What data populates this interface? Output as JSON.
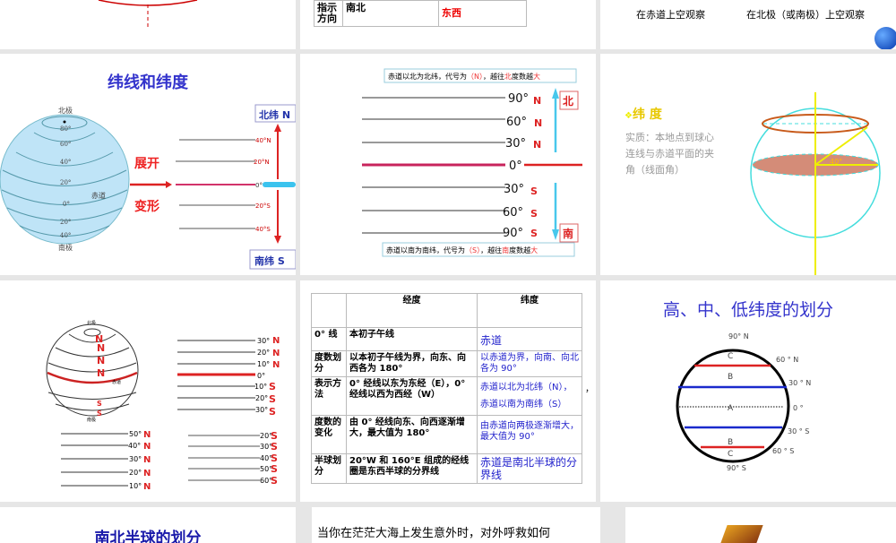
{
  "slides": {
    "s2": {
      "row_label": "指示方向",
      "lon": "南北",
      "lat": "东西"
    },
    "s3": {
      "caption_equator": "在赤道上空观察",
      "caption_pole": "在北极（或南极）上空观察"
    },
    "s4": {
      "title": "纬线和纬度",
      "north_pole": "北极",
      "south_pole": "南极",
      "equator": "赤道",
      "globe_labels": [
        "80°",
        "60°",
        "40°",
        "20°",
        "0°",
        "20°",
        "40°"
      ],
      "expand": "展开",
      "deform": "变形",
      "north_lat": "北纬 N",
      "south_lat": "南纬 S",
      "line_labels": [
        "40°N",
        "20°N",
        "0°",
        "20°S",
        "40°S"
      ]
    },
    "s5": {
      "north_note_pre": "赤道以北为北纬，代号为",
      "north_code": "（N）",
      "north_note_mid": "，越往",
      "north_word": "北",
      "note_deg": "度数越",
      "big": "大",
      "south_note_pre": "赤道以南为南纬，代号为",
      "south_code": "（S）",
      "south_note_mid": "，越往",
      "south_word": "南",
      "degrees": [
        "90°",
        "60°",
        "30°",
        "0°",
        "30°",
        "60°",
        "90°"
      ],
      "letters": [
        "N",
        "N",
        "N",
        "",
        "S",
        "S",
        "S"
      ],
      "north_tag": "北",
      "south_tag": "南"
    },
    "s6": {
      "heading": "纬 度",
      "text": "实质：本地点到球心连线与赤道平面的夹角（线面角）",
      "angle": "40°"
    },
    "s7": {
      "north_pole": "北极",
      "south_pole": "南极",
      "equator": "赤道",
      "globe_letters": [
        "N",
        "N",
        "N",
        "N",
        "S",
        "S"
      ],
      "right_degs": [
        "30°",
        "20°",
        "10°",
        "0°",
        "10°",
        "20°",
        "30°"
      ],
      "right_letters": [
        "N",
        "N",
        "N",
        "",
        "S",
        "S",
        "S"
      ],
      "left_bottom_degs": [
        "50°",
        "40°",
        "30°",
        "20°",
        "10°"
      ],
      "left_bottom_letters": [
        "N",
        "N",
        "N",
        "N",
        "N"
      ],
      "right_bottom_degs": [
        "20°",
        "30°",
        "40°",
        "50°",
        "60°"
      ],
      "right_bottom_letters": [
        "S",
        "S",
        "S",
        "S",
        "S"
      ]
    },
    "s8": {
      "headers": [
        "",
        "经度",
        "纬度"
      ],
      "rows": [
        [
          "0° 线",
          "本初子午线",
          "赤道"
        ],
        [
          "度数划分",
          "以本初子午线为界，向东、向西各为 180°",
          "以赤道为界，向南、向北各为 90°"
        ],
        [
          "表示方法",
          "0° 经线以东为东经（E），0° 经线以西为西经（W）",
          "赤道以北为北纬（N），赤道以南为南纬（S）"
        ],
        [
          "度数的变化",
          "由 0° 经线向东、向西逐渐增大，最大值为 180°",
          "由赤道向两极逐渐增大，最大值为 90°"
        ],
        [
          "半球划分",
          "20°W 和 160°E 组成的经线圈是东西半球的分界线",
          "赤道是南北半球的分界线"
        ]
      ],
      "comma": "，"
    },
    "s9": {
      "title": "高、中、低纬度的划分",
      "labels": [
        "90° N",
        "60 ° N",
        "30 ° N",
        "0 °",
        "30 ° S",
        "60 ° S",
        "90° S"
      ],
      "zones": [
        "C",
        "B",
        "A",
        "B",
        "C"
      ]
    },
    "s10": {
      "title": "南北半球的划分"
    },
    "s11": {
      "text": "当你在茫茫大海上发生意外时，对外呼救如何"
    }
  }
}
